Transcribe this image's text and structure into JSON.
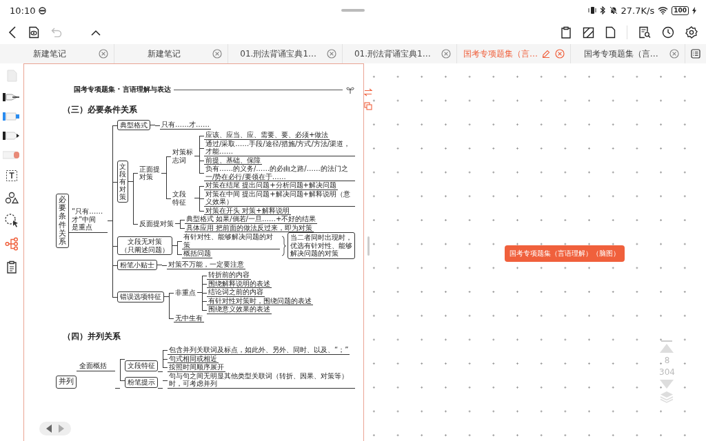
{
  "status_bar": {
    "time": "10:10",
    "speed": "27.7K/s",
    "battery": "100"
  },
  "tabs": [
    {
      "label": "新建笔记",
      "selected": false
    },
    {
      "label": "新建笔记",
      "selected": false
    },
    {
      "label": "01.刑法背诵宝典1…",
      "selected": false
    },
    {
      "label": "01.刑法背诵宝典1…",
      "selected": false
    },
    {
      "label": "国考专项题集（言…",
      "selected": true
    },
    {
      "label": "国考专项题集（言…",
      "selected": false
    }
  ],
  "tools": [
    {
      "kind": "page",
      "selected": false
    },
    {
      "kind": "pen",
      "selected": false
    },
    {
      "kind": "highlighter",
      "selected": false
    },
    {
      "kind": "marker",
      "selected": false
    },
    {
      "kind": "eraser",
      "selected": false
    },
    {
      "kind": "text",
      "selected": false
    },
    {
      "kind": "shapes",
      "selected": false
    },
    {
      "kind": "lasso",
      "selected": false
    },
    {
      "kind": "mindmap",
      "selected": true
    },
    {
      "kind": "clipboard",
      "selected": false
    }
  ],
  "page": {
    "header": "国考专项题集 · 言语理解与表达",
    "sections": [
      {
        "title": "（三）必要条件关系",
        "map": {
          "kind": "root",
          "label": "必要条件关系",
          "note": "“只有……才”中间是重点",
          "children": [
            {
              "kind": "box",
              "label": "典型格式",
              "children": [
                {
                  "kind": "leaf",
                  "label": "只有……才……"
                }
              ]
            },
            {
              "kind": "vbox",
              "label": "文段有对策",
              "children": [
                {
                  "kind": "label",
                  "label": "正面提对策",
                  "children": [
                    {
                      "kind": "label",
                      "label": "对策标志词",
                      "children": [
                        {
                          "kind": "leaf",
                          "label": "应该、应当、应、需要、要、必须+做法"
                        },
                        {
                          "kind": "leaf",
                          "label": "通过/采取……手段/途径/措施/方式/方法/渠道，才能……"
                        },
                        {
                          "kind": "leaf",
                          "label": "前提、基础、保障"
                        },
                        {
                          "kind": "leaf",
                          "label": "负有……的义务/……的必由之路/……的法门之一/势在必行/要领在于……"
                        }
                      ]
                    },
                    {
                      "kind": "label",
                      "label": "文段特征",
                      "children": [
                        {
                          "kind": "leaf",
                          "label": "对策在结尾  提出问题+分析问题+解决问题"
                        },
                        {
                          "kind": "leaf",
                          "label": "对策在中间  提出问题+解决问题+解释说明（意义效果）"
                        },
                        {
                          "kind": "leaf",
                          "label": "对策在开头  对策+解释说明"
                        }
                      ]
                    }
                  ]
                },
                {
                  "kind": "label-inline",
                  "label": "反面提对策",
                  "children": [
                    {
                      "kind": "leaf",
                      "label": "典型格式  如果/倘若/一旦……+不好的结果"
                    },
                    {
                      "kind": "leaf",
                      "label": "具体应用  把前面的做法反过来，即为对策"
                    }
                  ]
                }
              ]
            },
            {
              "kind": "box-wrap",
              "label": "文段无对策（只阐述问题）",
              "summary": "当二者同时出现时，优选有针对性、能够解决问题的对策",
              "children": [
                {
                  "kind": "leaf",
                  "label": "有针对性、能够解决问题的对策"
                },
                {
                  "kind": "leaf",
                  "label": "概括问题"
                }
              ]
            },
            {
              "kind": "box",
              "label": "粉笔小贴士",
              "children": [
                {
                  "kind": "leaf",
                  "label": "对策不万能，一定要注意"
                }
              ]
            },
            {
              "kind": "box",
              "label": "错误选项特征",
              "children": [
                {
                  "kind": "label-inline",
                  "label": "非重点",
                  "children": [
                    {
                      "kind": "leaf",
                      "label": "转折前的内容"
                    },
                    {
                      "kind": "leaf",
                      "label": "围绕解释说明的表述"
                    },
                    {
                      "kind": "leaf",
                      "label": "结论词之前的内容"
                    },
                    {
                      "kind": "leaf",
                      "label": "有针对性对策时，围绕问题的表述"
                    },
                    {
                      "kind": "leaf",
                      "label": "围绕意义效果的表述"
                    }
                  ]
                },
                {
                  "kind": "leaf",
                  "label": "无中生有"
                }
              ]
            }
          ]
        }
      },
      {
        "title": "（四）并列关系",
        "map": {
          "kind": "root-h",
          "label": "并列",
          "note": "全面概括",
          "children": [
            {
              "kind": "box",
              "label": "文段特征",
              "children": [
                {
                  "kind": "leaf",
                  "label": "包含并列关联词及标点，如此外、另外、同时、以及、“；”"
                },
                {
                  "kind": "leaf",
                  "label": "句式相同或相近"
                },
                {
                  "kind": "leaf",
                  "label": "按照时间顺序展开"
                }
              ]
            },
            {
              "kind": "box",
              "label": "粉笔提示",
              "children": [
                {
                  "kind": "leaf",
                  "label": "句与句之间无明显其他类型关联词（转折、因果、对策等）时，可考虑并列"
                }
              ]
            }
          ]
        }
      }
    ]
  },
  "canvas": {
    "node": "国考专项题集（言语理解）（脑图）",
    "page_number": "8",
    "page_count": "304"
  }
}
